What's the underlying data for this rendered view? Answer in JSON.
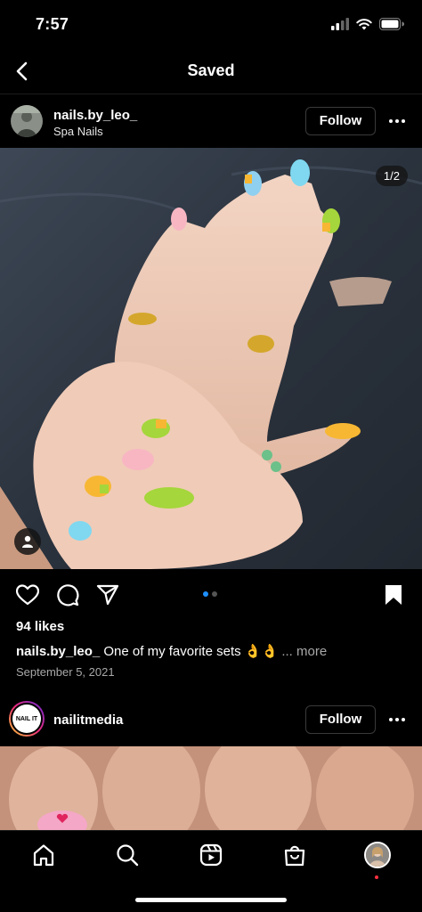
{
  "status_bar": {
    "time": "7:57"
  },
  "nav": {
    "title": "Saved"
  },
  "posts": [
    {
      "username": "nails.by_leo_",
      "subtitle": "Spa Nails",
      "follow_label": "Follow",
      "counter": "1/2",
      "likes": "94 likes",
      "caption_user": "nails.by_leo_",
      "caption_text": " One of my favorite sets 👌👌",
      "caption_more": "... more",
      "date": "September 5, 2021"
    },
    {
      "username": "nailitmedia",
      "avatar_text": "NAIL IT",
      "follow_label": "Follow"
    }
  ],
  "carousel": {
    "total": 2,
    "active": 1
  },
  "icons": {
    "back": "chevron-left-icon",
    "more": "more-horizontal-icon",
    "like": "heart-icon",
    "comment": "comment-icon",
    "share": "paper-plane-icon",
    "save": "bookmark-filled-icon",
    "tag": "person-icon"
  },
  "tab_bar": [
    "home-icon",
    "search-icon",
    "reels-icon",
    "shop-icon",
    "profile-avatar"
  ],
  "colors": {
    "accent": "#1e90ff",
    "background": "#000000",
    "notification_dot": "#ff3040"
  }
}
